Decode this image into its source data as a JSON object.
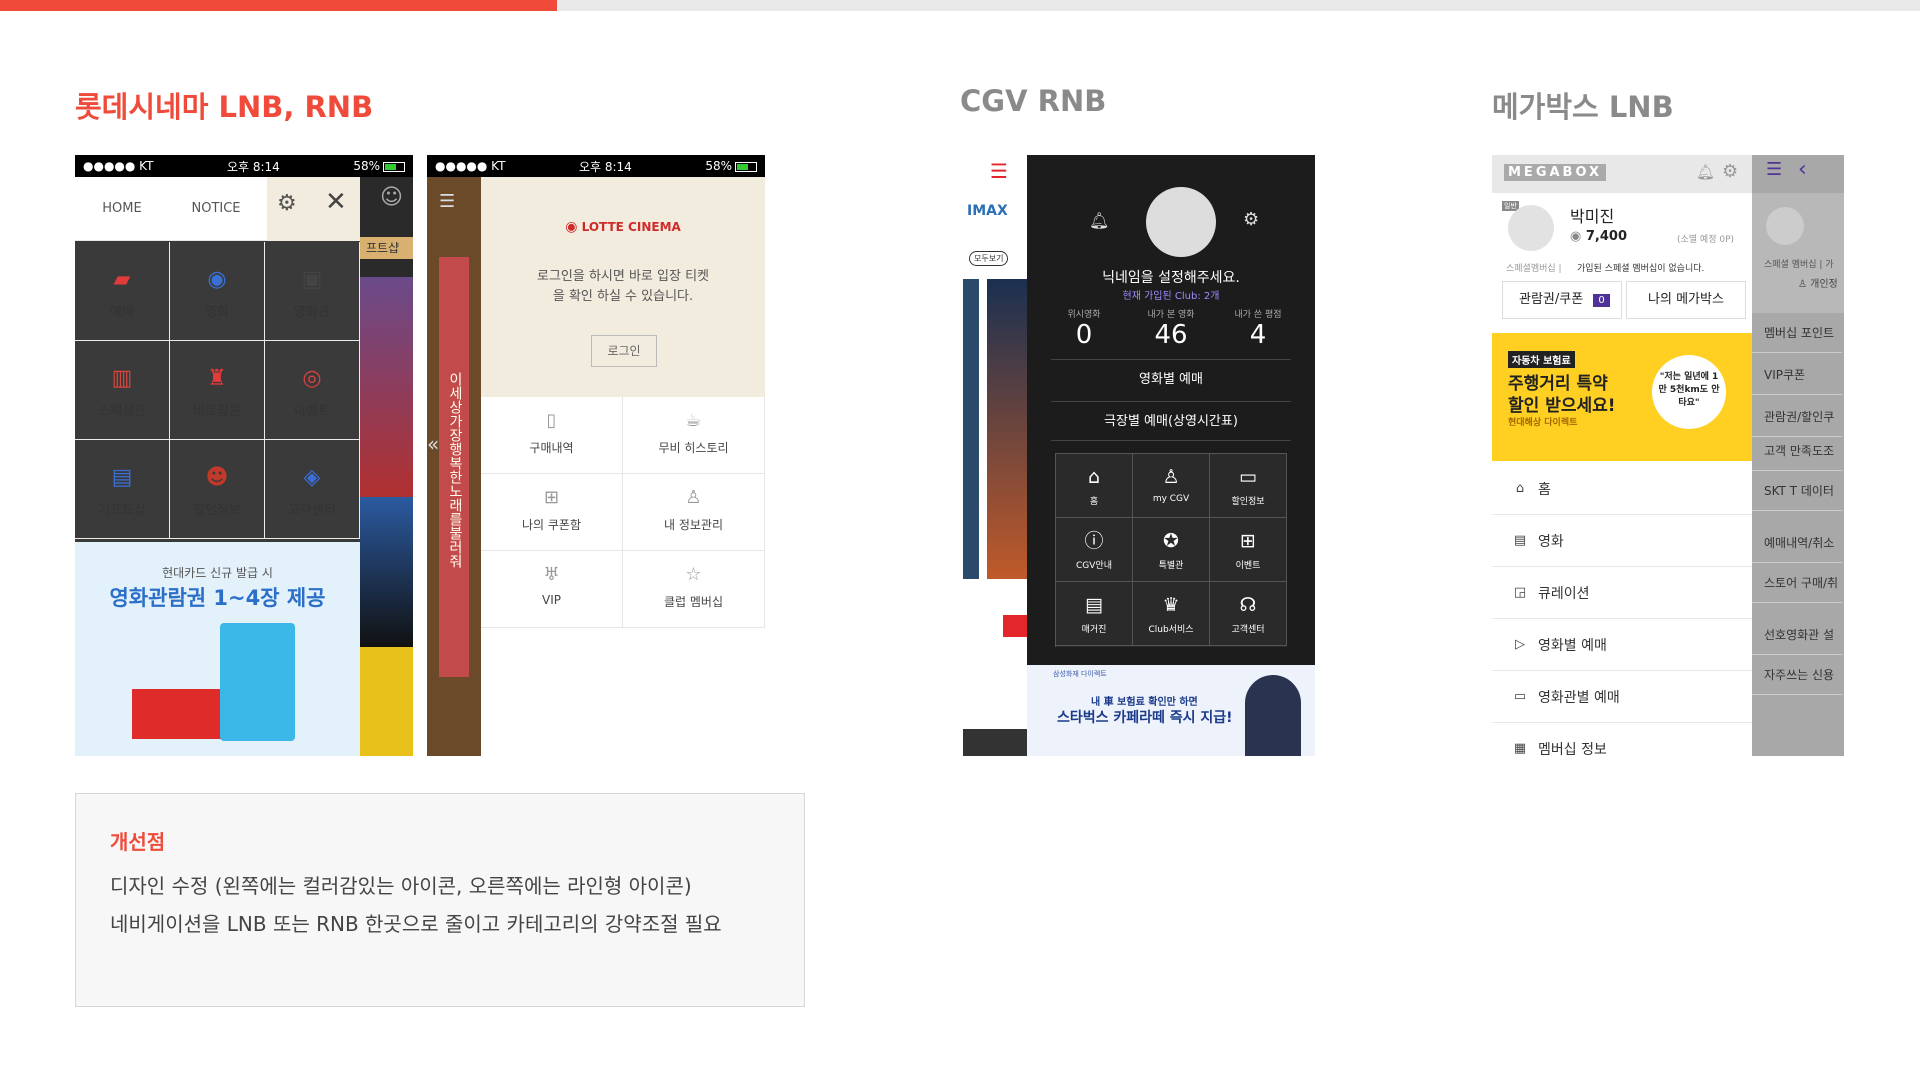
{
  "progress": {
    "fraction": 0.29,
    "fill_color": "#ef4a3a",
    "track_color": "#e9e9e9"
  },
  "sections": {
    "lotte_title": "롯데시네마 LNB, RNB",
    "cgv_title": "CGV RNB",
    "megabox_title": "메가박스 LNB"
  },
  "statusbar": {
    "carrier": "●●●●● KT",
    "time": "오후 8:14",
    "battery": "58%"
  },
  "lotte_lnb": {
    "tabs": [
      "HOME",
      "NOTICE"
    ],
    "grid": [
      {
        "label": "예매",
        "icon": "ticket-icon"
      },
      {
        "label": "영화",
        "icon": "film-reel-icon"
      },
      {
        "label": "영화관",
        "icon": "cinema-icon"
      },
      {
        "label": "스페셜관",
        "icon": "books-icon"
      },
      {
        "label": "바로팝콘",
        "icon": "popcorn-icon"
      },
      {
        "label": "이벤트",
        "icon": "event-icon"
      },
      {
        "label": "기프트샵",
        "icon": "gift-icon"
      },
      {
        "label": "할인정보",
        "icon": "discount-icon"
      },
      {
        "label": "고객센터",
        "icon": "customer-center-icon"
      }
    ],
    "ad_line1": "현대카드 신규 발급 시",
    "ad_line2": "영화관람권 1~4장 제공",
    "bg_label": "프트샵"
  },
  "lotte_rnb": {
    "brand": "LOTTE CINEMA",
    "login_msg_1": "로그인을 하시면 바로 입장 티켓",
    "login_msg_2": "을 확인 하실 수 있습니다.",
    "login_button": "로그인",
    "items": [
      {
        "label": "구매내역",
        "icon": "receipt-icon"
      },
      {
        "label": "무비 히스토리",
        "icon": "cup-icon"
      },
      {
        "label": "나의 쿠폰함",
        "icon": "gift-box-icon"
      },
      {
        "label": "내 정보관리",
        "icon": "user-icon"
      },
      {
        "label": "VIP",
        "icon": "trophy-icon"
      },
      {
        "label": "클럽 멤버십",
        "icon": "star-icon"
      }
    ],
    "side_text": "이세상가장행복한노래를불러줘"
  },
  "cgv": {
    "nickname": "닉네임을 설정해주세요.",
    "club": "현재 가입된 Club: 2개",
    "stats": [
      {
        "label": "위시영화",
        "value": "0"
      },
      {
        "label": "내가 본 영화",
        "value": "46"
      },
      {
        "label": "내가 쓴 평점",
        "value": "4"
      }
    ],
    "menu1": "영화별 예매",
    "menu2": "극장별 예매(상영시간표)",
    "grid": [
      {
        "label": "홈",
        "icon": "home-icon"
      },
      {
        "label": "my CGV",
        "icon": "my-cgv-icon"
      },
      {
        "label": "할인정보",
        "icon": "card-icon"
      },
      {
        "label": "CGV안내",
        "icon": "info-icon"
      },
      {
        "label": "특별관",
        "icon": "special-icon"
      },
      {
        "label": "이벤트",
        "icon": "gift-icon"
      },
      {
        "label": "매거진",
        "icon": "magazine-icon"
      },
      {
        "label": "Club서비스",
        "icon": "crown-icon"
      },
      {
        "label": "고객센터",
        "icon": "headset-icon"
      }
    ],
    "ad_small": "삼성화재 다이렉트",
    "ad_line1": "내 車 보험료 확인만 하면",
    "ad_line2": "스타벅스 카페라떼 즉시 지급!",
    "bg_imax": "IMAX",
    "bg_all": "모두보기"
  },
  "megabox": {
    "logo": "MEGABOX",
    "user_name": "박미진",
    "points": "7,400",
    "expire": "(소멸 예정 0P)",
    "member_tag": "일반",
    "member_note_1": "스페셜멤버십 |",
    "member_note_2": "가입된 스페셜 멤버십이 없습니다.",
    "coupon_label": "관람권/쿠폰",
    "coupon_count": "0",
    "my_megabox": "나의 메가박스",
    "ad_tag": "자동차 보험료",
    "ad_line1": "주행거리 특약",
    "ad_line2": "할인 받으세요!",
    "ad_brand": "현대해상 다이렉트",
    "ad_quote": "\"저는 일년에 1만 5천km도 안타요\"",
    "menu": [
      {
        "label": "홈",
        "icon": "home-icon"
      },
      {
        "label": "영화",
        "icon": "film-icon"
      },
      {
        "label": "큐레이션",
        "icon": "curation-icon"
      },
      {
        "label": "영화별 예매",
        "icon": "play-icon"
      },
      {
        "label": "영화관별 예매",
        "icon": "theater-icon"
      },
      {
        "label": "멤버십 정보",
        "icon": "membership-icon"
      }
    ],
    "right_items": [
      "멤버십 포인트",
      "VIP쿠폰",
      "관람권/할인쿠",
      "고객 만족도조",
      "SKT T 데이터",
      "예매내역/취소",
      "스토어 구매/취",
      "선호영화관 설",
      "자주쓰는 신용"
    ],
    "right_top_note": "스페셜 멤버십 | 가",
    "right_login": "개인정"
  },
  "note": {
    "title": "개선점",
    "line1": "디자인 수정 (왼쪽에는 컬러감있는 아이콘, 오른쪽에는 라인형 아이콘)",
    "line2": "네비게이션을 LNB 또는 RNB 한곳으로 줄이고 카테고리의 강약조절 필요"
  },
  "colors": {
    "accent": "#ef4a3a",
    "gray_title": "#8a8a8a",
    "megabox_purple": "#503396",
    "ad_yellow": "#ffd022",
    "cgv_red": "#e3262c"
  }
}
